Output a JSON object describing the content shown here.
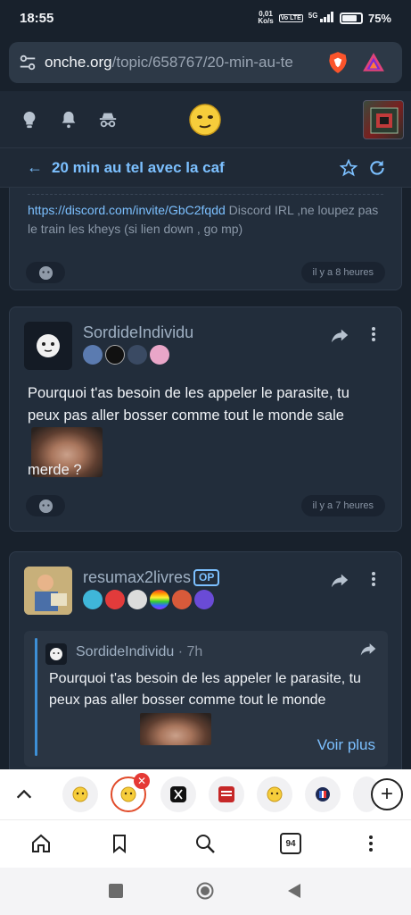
{
  "status": {
    "time": "18:55",
    "net_speed_top": "0,01",
    "net_speed_bottom": "Ko/s",
    "lte": "Vo LTE",
    "signal": "5G",
    "battery": "75%"
  },
  "browser": {
    "url_host": "onche.org",
    "url_path": "/topic/658767/20-min-au-te",
    "tab_count": "94"
  },
  "topic": {
    "title": "20 min au tel avec la caf"
  },
  "posts": [
    {
      "link": "https://discord.com/invite/GbC2fqdd",
      "text": " Discord IRL ,ne loupez pas le train les kheys (si lien down , go mp)",
      "time": "il y a 8 heures"
    },
    {
      "author": "SordideIndividu",
      "text_line1": "Pourquoi t'as besoin de les appeler le parasite, tu peux pas aller bosser comme tout le monde sale",
      "text_line2": "merde ?",
      "time": "il y a 7 heures",
      "badge_colors": [
        "#5b7bb0",
        "#111111",
        "#3a4a63",
        "#e9a6c8"
      ]
    },
    {
      "author": "resumax2livres",
      "op_label": "OP",
      "badge_colors": [
        "#3fb6d9",
        "#e23b3b",
        "#dcdcdc",
        "#f0c23a",
        "#d85a3a",
        "#6a4bd6"
      ],
      "quote": {
        "author": "SordideIndividu",
        "time": "· 7h",
        "text": "Pourquoi t'as besoin de les appeler le parasite, tu peux pas aller bosser comme tout le monde",
        "more": "Voir plus"
      }
    }
  ],
  "tabs": [
    "onche-emoji",
    "onche-emoji-active",
    "x-logo",
    "news-logo",
    "onche-emoji",
    "france-logo"
  ],
  "colors": {
    "accent": "#7cc0ff",
    "card": "#222d3b",
    "background": "#18212c"
  }
}
